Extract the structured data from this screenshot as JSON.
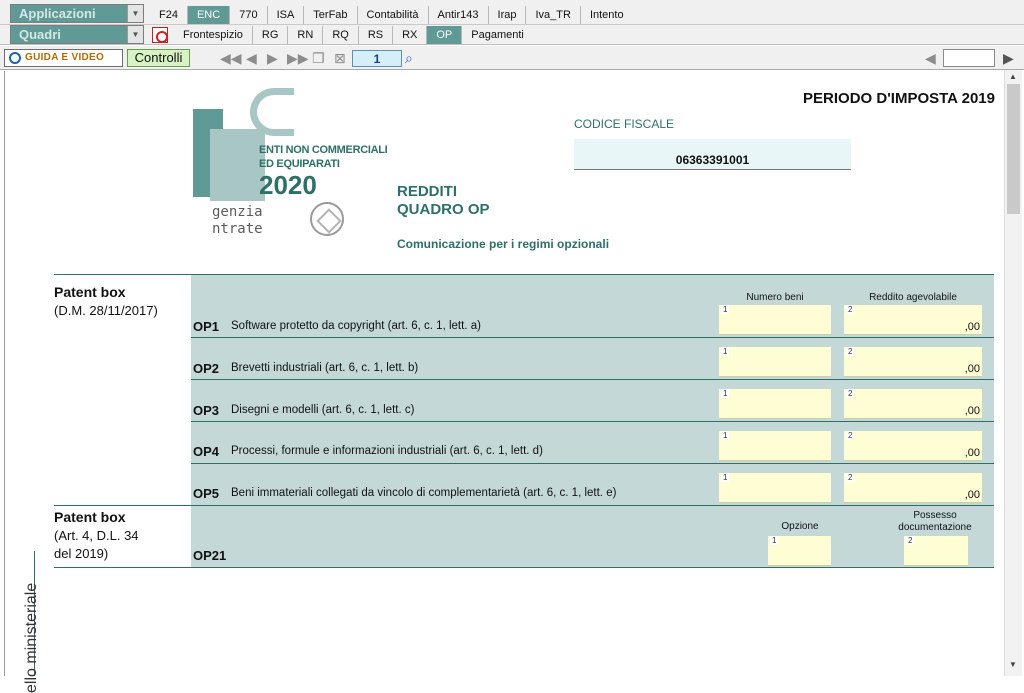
{
  "menu": {
    "applicazioni": "Applicazioni",
    "quadri": "Quadri",
    "top_tabs": [
      "F24",
      "ENC",
      "770",
      "ISA",
      "TerFab",
      "Contabilità",
      "Antir143",
      "Irap",
      "Iva_TR",
      "Intento"
    ],
    "top_active": "ENC",
    "sub_tabs": [
      "Frontespizio",
      "RG",
      "RN",
      "RQ",
      "RS",
      "RX",
      "OP",
      "Pagamenti"
    ],
    "sub_active": "OP"
  },
  "toolbar": {
    "guida": "GUIDA E VIDEO",
    "controlli": "Controlli",
    "page": "1"
  },
  "form": {
    "periodo": "PERIODO D'IMPOSTA 2019",
    "cf_label": "CODICE FISCALE",
    "cf_value": "06363391001",
    "logo_line1": "ENTI NON COMMERCIALI",
    "logo_line2": "ED EQUIPARATI",
    "logo_year": "2020",
    "agenzia_1": "genzia",
    "agenzia_2": "ntrate",
    "redditi": "REDDITI",
    "quadro": "QUADRO OP",
    "comunicazione": "Comunicazione per i regimi opzionali",
    "section1_title": "Patent box",
    "section1_sub": "(D.M. 28/11/2017)",
    "section2_title": "Patent box",
    "section2_sub1": "(Art. 4, D.L. 34",
    "section2_sub2": "del 2019)",
    "col_numero": "Numero beni",
    "col_reddito": "Reddito agevolabile",
    "col_opzione": "Opzione",
    "col_possesso1": "Possesso",
    "col_possesso2": "documentazione",
    "rows": [
      {
        "code": "OP1",
        "desc": "Software protetto da copyright (art. 6, c. 1, lett. a)"
      },
      {
        "code": "OP2",
        "desc": "Brevetti industriali (art. 6, c. 1, lett. b)"
      },
      {
        "code": "OP3",
        "desc": "Disegni e modelli (art. 6, c. 1, lett. c)"
      },
      {
        "code": "OP4",
        "desc": "Processi, formule e informazioni industriali (art. 6, c. 1, lett. d)"
      },
      {
        "code": "OP5",
        "desc": "Beni immateriali collegati da vincolo di complementarietà (art. 6, c. 1, lett. e)"
      }
    ],
    "op21_code": "OP21",
    "field_num_1": "1",
    "field_num_2": "2",
    "decimal_suffix": ",00",
    "vertical_text": "ello ministeriale"
  }
}
